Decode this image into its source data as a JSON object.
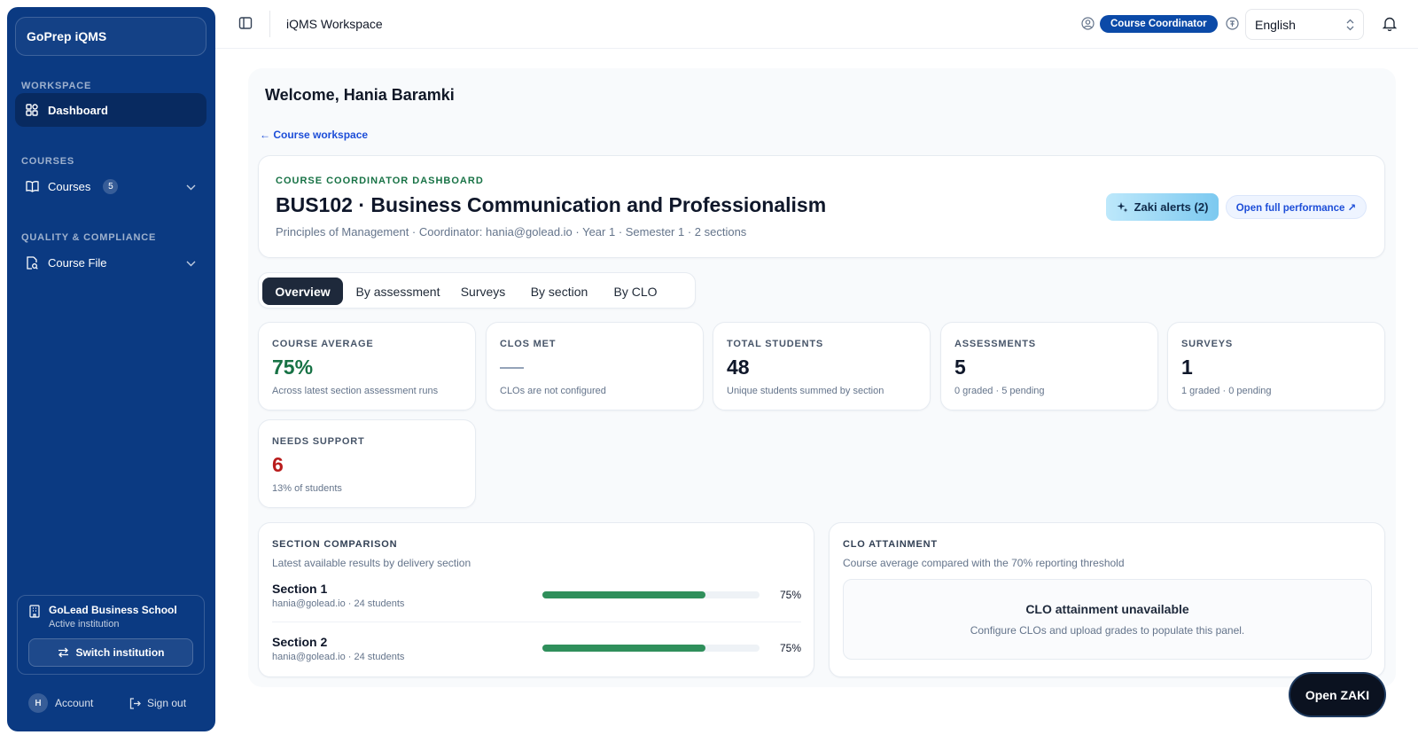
{
  "sidebar": {
    "brand": "GoPrep iQMS",
    "sections": {
      "workspace": "WORKSPACE",
      "courses": "COURSES",
      "quality": "QUALITY & COMPLIANCE"
    },
    "items": {
      "dashboard": "Dashboard",
      "courses": "Courses",
      "courses_count": "5",
      "course_file": "Course File"
    },
    "institution": {
      "name": "GoLead Business School",
      "status": "Active institution",
      "switch_label": "Switch institution"
    },
    "account": {
      "avatar_initial": "H",
      "account_label": "Account",
      "signout_label": "Sign out"
    }
  },
  "topbar": {
    "title": "iQMS Workspace",
    "role": "Course Coordinator",
    "language": "English"
  },
  "main": {
    "welcome": "Welcome, Hania Baramki",
    "back_link": "← Course workspace",
    "hero": {
      "kicker": "COURSE COORDINATOR DASHBOARD",
      "title": "BUS102 · Business Communication and Professionalism",
      "meta": "Principles of Management · Coordinator: hania@golead.io · Year 1 · Semester 1 · 2 sections",
      "zaki_alerts": "Zaki alerts (2)",
      "open_performance": "Open full performance ↗"
    },
    "tabs": [
      "Overview",
      "By assessment",
      "Surveys",
      "By section",
      "By CLO"
    ],
    "stats": [
      {
        "label": "COURSE AVERAGE",
        "value": "75%",
        "sub": "Across latest section assessment runs",
        "color": "#177245"
      },
      {
        "label": "CLOS MET",
        "value": "",
        "sub": "CLOs are not configured",
        "color": "#0f172a"
      },
      {
        "label": "TOTAL STUDENTS",
        "value": "48",
        "sub": "Unique students summed by section",
        "color": "#0f172a"
      },
      {
        "label": "ASSESSMENTS",
        "value": "5",
        "sub": "0 graded · 5 pending",
        "color": "#0f172a"
      },
      {
        "label": "SURVEYS",
        "value": "1",
        "sub": "1 graded · 0 pending",
        "color": "#0f172a"
      },
      {
        "label": "NEEDS SUPPORT",
        "value": "6",
        "sub": "13% of students",
        "color": "#b91c1c"
      }
    ],
    "section_comparison": {
      "title": "SECTION COMPARISON",
      "subtitle": "Latest available results by delivery section",
      "rows": [
        {
          "name": "Section 1",
          "meta": "hania@golead.io · 24 students",
          "pct_label": "75%",
          "pct": 75
        },
        {
          "name": "Section 2",
          "meta": "hania@golead.io · 24 students",
          "pct_label": "75%",
          "pct": 75
        }
      ]
    },
    "clo_attainment": {
      "title": "CLO ATTAINMENT",
      "subtitle": "Course average compared with the 70% reporting threshold",
      "empty_title": "CLO attainment unavailable",
      "empty_sub": "Configure CLOs and upload grades to populate this panel."
    },
    "open_zaki": "Open ZAKI"
  },
  "colors": {
    "sidebar": "#0b3a82",
    "accent": "#0b4aa8",
    "success": "#2f8f5b",
    "danger": "#b91c1c"
  }
}
